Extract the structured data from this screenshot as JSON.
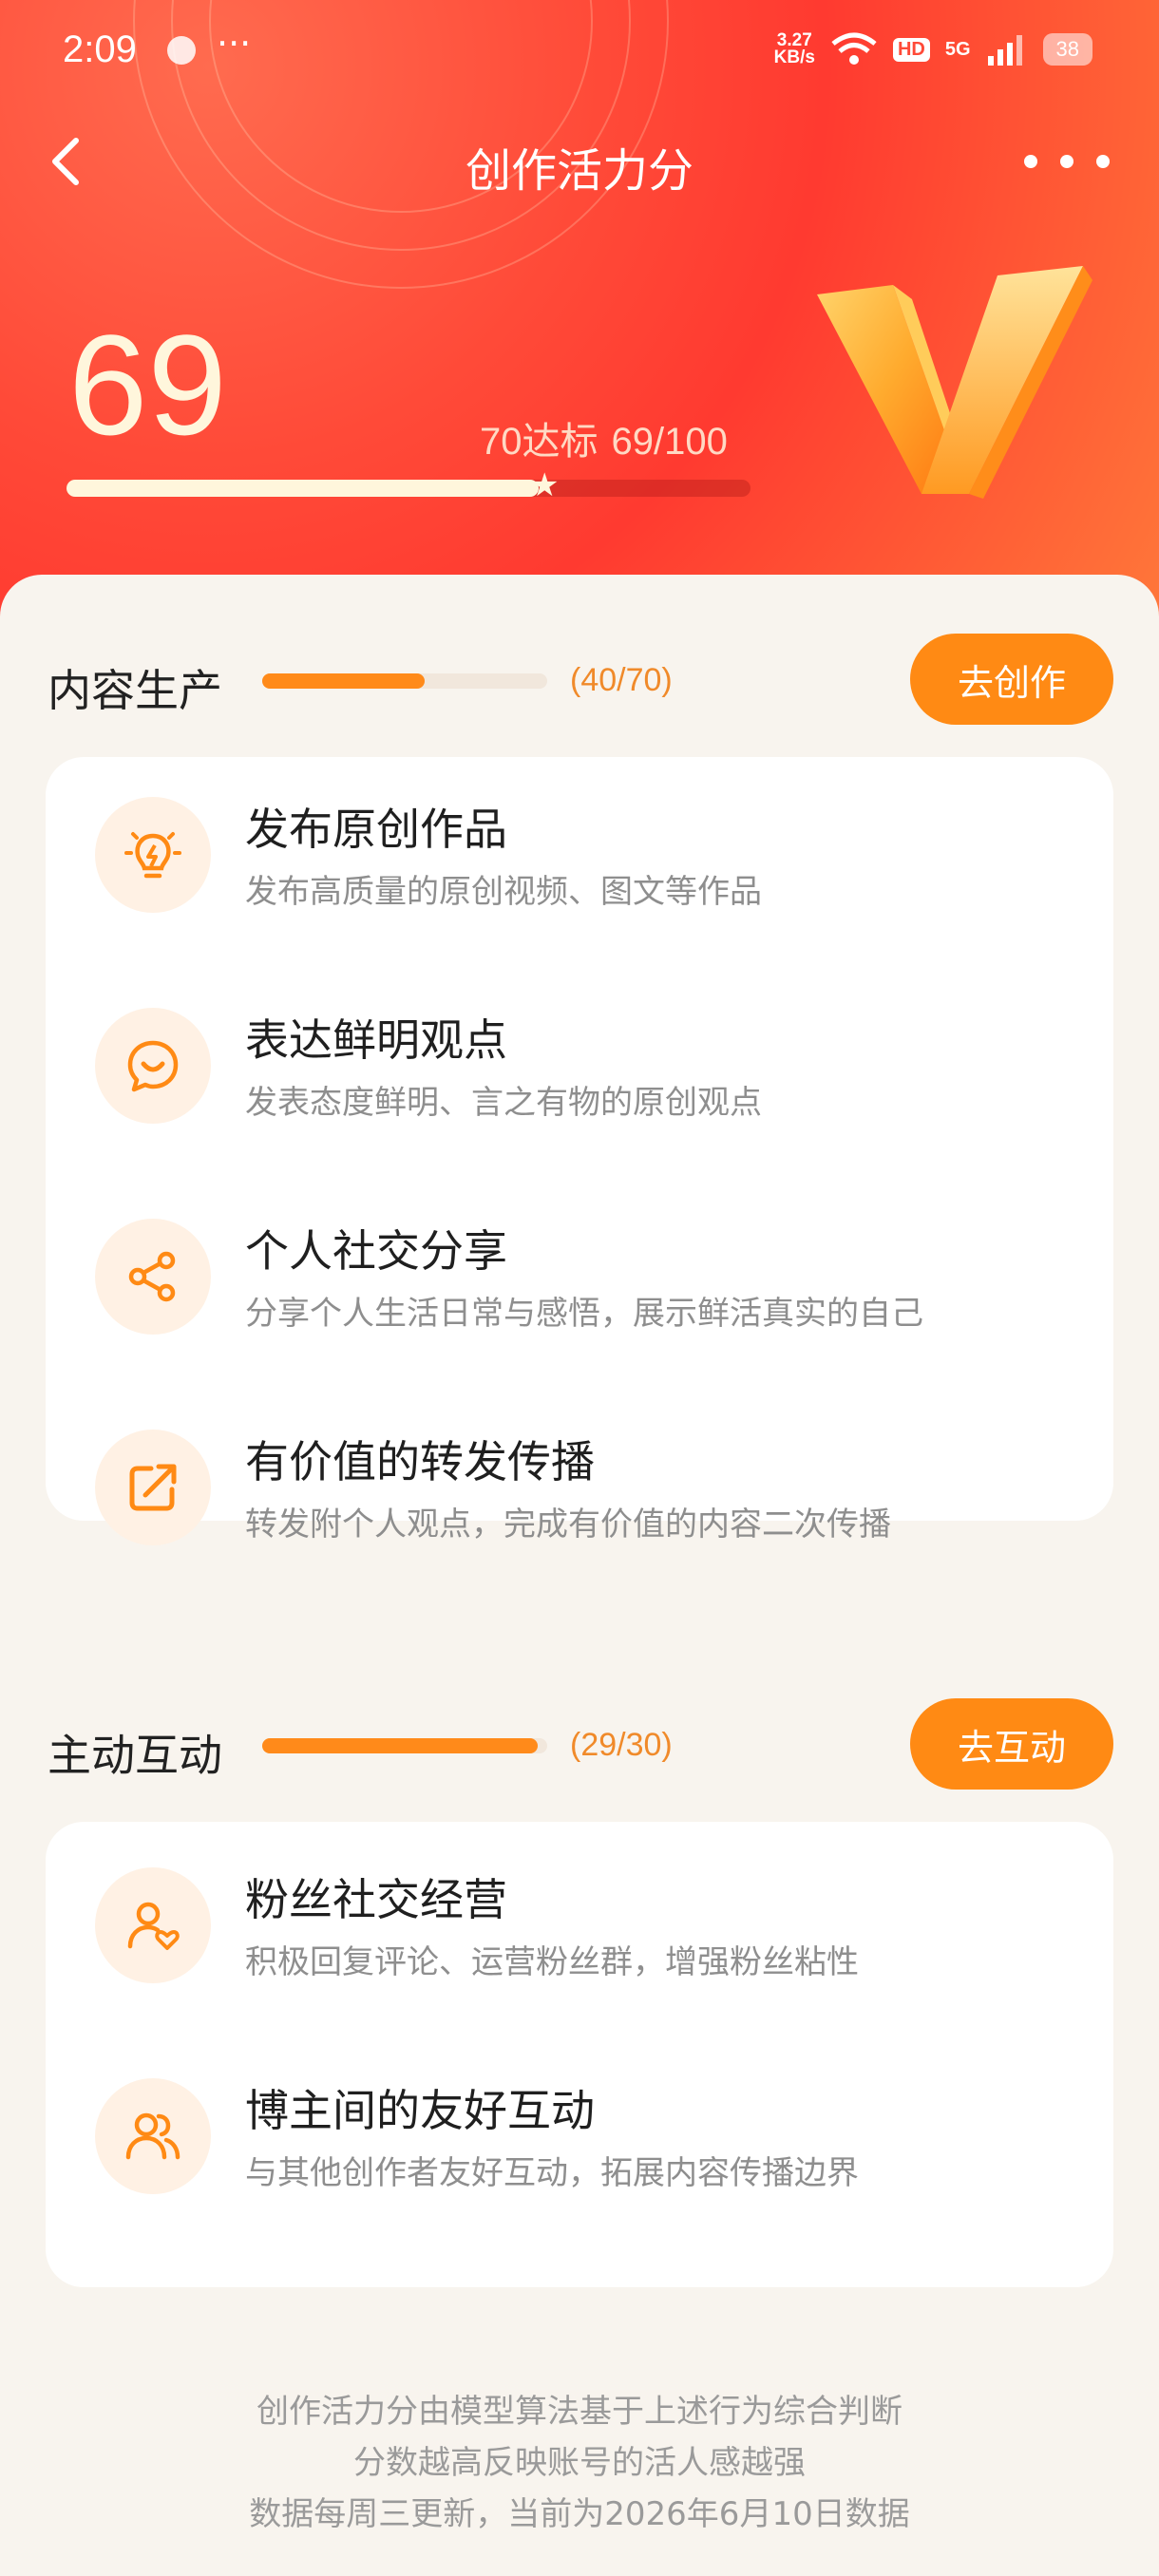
{
  "status_bar": {
    "time": "2:09",
    "dots": "···",
    "speed_value": "3.27",
    "speed_unit": "KB/s",
    "hd": "HD",
    "network": "5G",
    "battery": "38"
  },
  "nav": {
    "title": "创作活力分"
  },
  "score": {
    "value": "69",
    "target_label": "70达标",
    "progress_text": "69/100",
    "progress": 0.69,
    "target_fraction": 0.7
  },
  "sections": [
    {
      "title": "内容生产",
      "count": "(40/70)",
      "progress": 0.571,
      "button": "去创作",
      "items": [
        {
          "icon": "lightbulb-icon",
          "title": "发布原创作品",
          "desc": "发布高质量的原创视频、图文等作品"
        },
        {
          "icon": "chat-bubble-icon",
          "title": "表达鲜明观点",
          "desc": "发表态度鲜明、言之有物的原创观点"
        },
        {
          "icon": "share-icon",
          "title": "个人社交分享",
          "desc": "分享个人生活日常与感悟，展示鲜活真实的自己"
        },
        {
          "icon": "forward-icon",
          "title": "有价值的转发传播",
          "desc": "转发附个人观点，完成有价值的内容二次传播"
        }
      ]
    },
    {
      "title": "主动互动",
      "count": "(29/30)",
      "progress": 0.967,
      "button": "去互动",
      "items": [
        {
          "icon": "fan-heart-icon",
          "title": "粉丝社交经营",
          "desc": "积极回复评论、运营粉丝群，增强粉丝粘性"
        },
        {
          "icon": "users-icon",
          "title": "博主间的友好互动",
          "desc": "与其他创作者友好互动，拓展内容传播边界"
        }
      ]
    }
  ],
  "footer": {
    "line1": "创作活力分由模型算法基于上述行为综合判断",
    "line2": "分数越高反映账号的活人感越强",
    "line3": "数据每周三更新，当前为2026年6月10日数据"
  },
  "colors": {
    "accent": "#ff8a14",
    "header": "#ff3a30",
    "score_text": "#fff6dc"
  }
}
